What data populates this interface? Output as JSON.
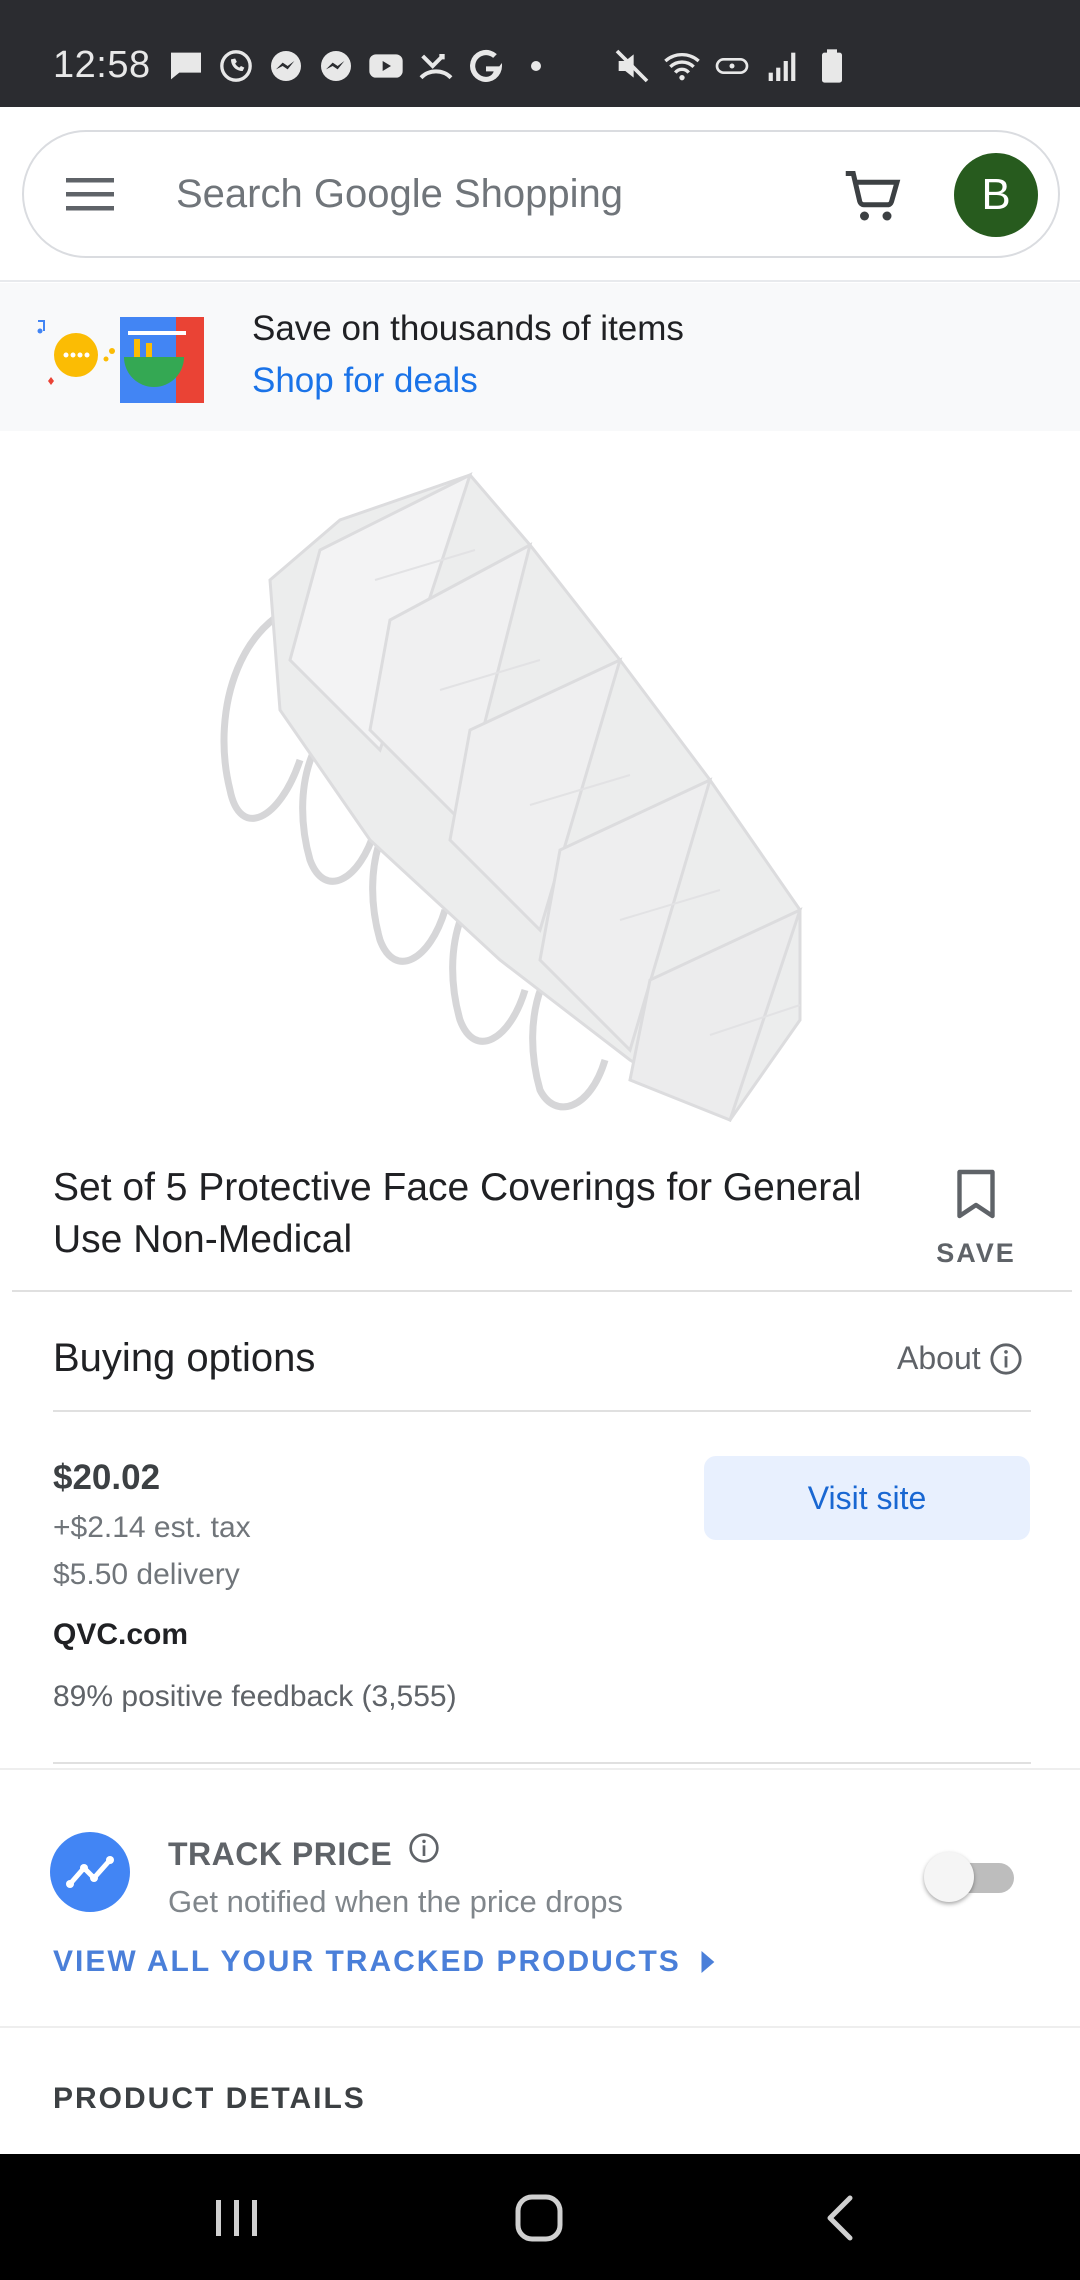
{
  "status_bar": {
    "time": "12:58",
    "left_icons": [
      "message-icon",
      "whatsapp-icon",
      "messenger-icon",
      "messenger-icon",
      "youtube-icon",
      "missed-call-icon",
      "google-icon",
      "dot-icon"
    ],
    "right_icons": [
      "mute-icon",
      "wifi-icon",
      "volte-icon",
      "signal-icon",
      "battery-icon"
    ]
  },
  "search": {
    "placeholder": "Search Google Shopping",
    "avatar_initial": "B",
    "avatar_color": "#275b1e"
  },
  "deals": {
    "title": "Save on thousands of items",
    "link": "Shop for deals"
  },
  "product": {
    "title": "Set of 5 Protective Face Coverings for General Use Non-Medical",
    "save_label": "SAVE"
  },
  "buying_options": {
    "heading": "Buying options",
    "about": "About",
    "price": "$20.02",
    "tax": "+$2.14 est. tax",
    "delivery": "$5.50 delivery",
    "merchant": "QVC.com",
    "feedback": "89% positive feedback (3,555)",
    "visit_label": "Visit site"
  },
  "track_price": {
    "title": "TRACK PRICE",
    "subtitle": "Get notified when the price drops",
    "enabled": false,
    "view_all": "VIEW ALL YOUR TRACKED PRODUCTS"
  },
  "details": {
    "heading": "PRODUCT DETAILS"
  },
  "colors": {
    "accent_blue": "#1a73e8",
    "track_blue": "#4285f4"
  }
}
